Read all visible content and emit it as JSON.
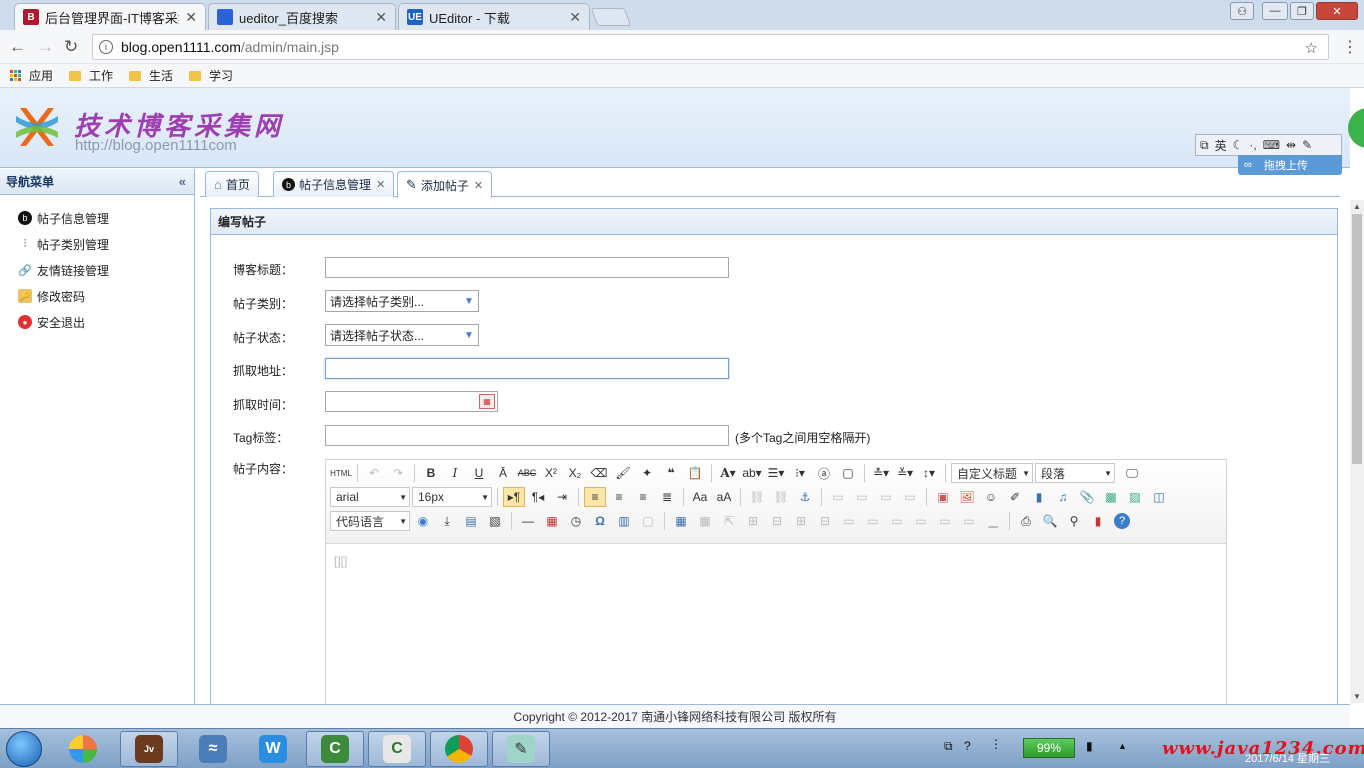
{
  "browser": {
    "tabs": [
      {
        "title": "后台管理界面-IT博客采集",
        "icon": "B"
      },
      {
        "title": "ueditor_百度搜索",
        "icon": "du"
      },
      {
        "title": "UEditor - 下载",
        "icon": "UE"
      }
    ],
    "url_host": "blog.open1111.com",
    "url_path": "/admin/main.jsp",
    "bookmarks": [
      "应用",
      "工作",
      "生活",
      "学习"
    ]
  },
  "header": {
    "brand": "技术博客采集网",
    "subtitle": "http://blog.open1111com",
    "ime_label": "英",
    "upload_label": "拖拽上传"
  },
  "sidebar": {
    "title": "导航菜单",
    "items": [
      {
        "label": "帖子信息管理",
        "icon": "b-circle-icon"
      },
      {
        "label": "帖子类别管理",
        "icon": "tree-icon"
      },
      {
        "label": "友情链接管理",
        "icon": "link-icon"
      },
      {
        "label": "修改密码",
        "icon": "key-folder-icon"
      },
      {
        "label": "安全退出",
        "icon": "exit-icon"
      }
    ]
  },
  "page_tabs": [
    {
      "label": "首页",
      "icon": "home-icon",
      "closable": false
    },
    {
      "label": "帖子信息管理",
      "icon": "b-circle-icon",
      "closable": true
    },
    {
      "label": "添加帖子",
      "icon": "edit-icon",
      "closable": true
    }
  ],
  "panel": {
    "title": "编写帖子",
    "fields": {
      "blog_title": {
        "label": "博客标题：",
        "value": ""
      },
      "category": {
        "label": "帖子类别：",
        "selected": "请选择帖子类别..."
      },
      "status": {
        "label": "帖子状态：",
        "selected": "请选择帖子状态..."
      },
      "crawl_url": {
        "label": "抓取地址：",
        "value": ""
      },
      "crawl_time": {
        "label": "抓取时间：",
        "value": ""
      },
      "tags": {
        "label": "Tag标签：",
        "value": "",
        "hint": "(多个Tag之间用空格隔开)"
      },
      "content": {
        "label": "帖子内容："
      }
    },
    "editor": {
      "heading_select": "自定义标题",
      "paragraph_select": "段落",
      "font_family": "arial",
      "font_size": "16px",
      "code_lang": "代码语言",
      "body_placeholder": "[][]"
    }
  },
  "footer": {
    "text": "Copyright © 2012-2017 南通小锋网络科技有限公司 版权所有"
  },
  "taskbar": {
    "battery": "99%",
    "watermark": "www.java1234.com",
    "date": "2017/6/14 星期三"
  }
}
